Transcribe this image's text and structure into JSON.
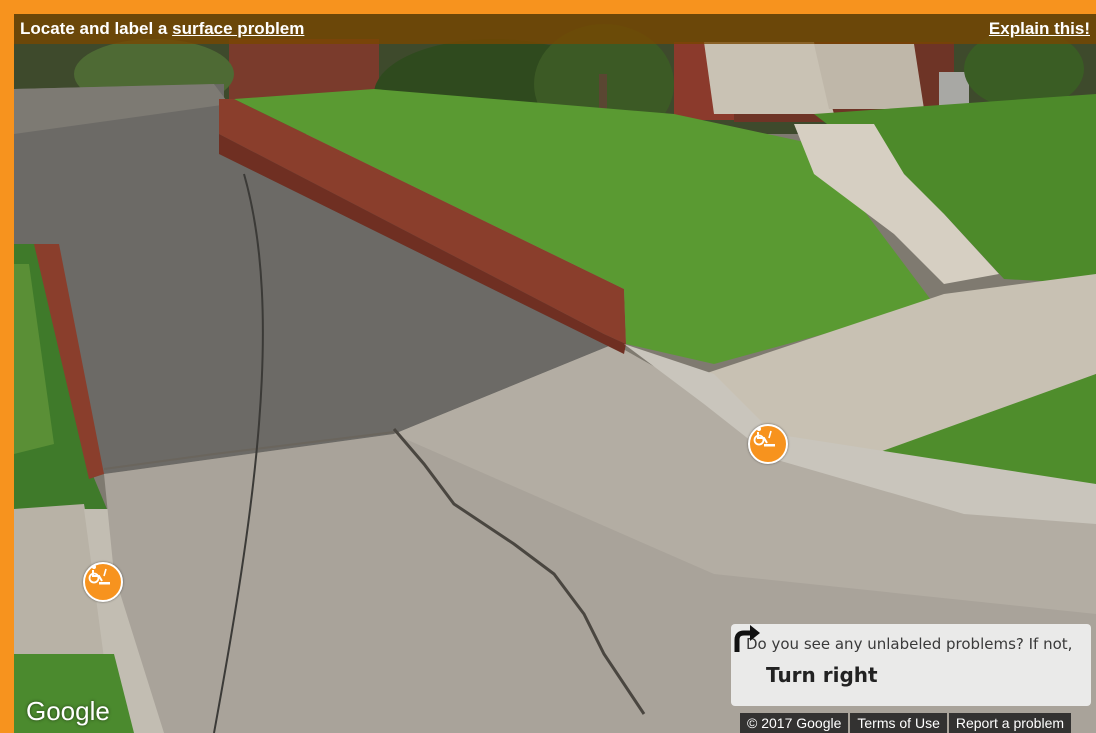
{
  "task": {
    "title_prefix": "Locate and label a ",
    "title_link": "surface problem",
    "explain_label": "Explain this!"
  },
  "prompt": {
    "question": "Do you see any unlabeled problems? If not,",
    "turn_label": "Turn right"
  },
  "logo": "Google",
  "footer": {
    "copyright": "© 2017 Google",
    "terms": "Terms of Use",
    "report": "Report a problem"
  },
  "markers": [
    {
      "label_type": "surface problem",
      "icon": "wheelchair-surface-icon"
    },
    {
      "label_type": "surface problem",
      "icon": "wheelchair-surface-icon"
    }
  ],
  "colors": {
    "accent": "#f7931e",
    "topbar": "#784600",
    "grass": "#4e8f2e",
    "concrete": "#b7b1a5",
    "brick": "#8a3e2c"
  }
}
